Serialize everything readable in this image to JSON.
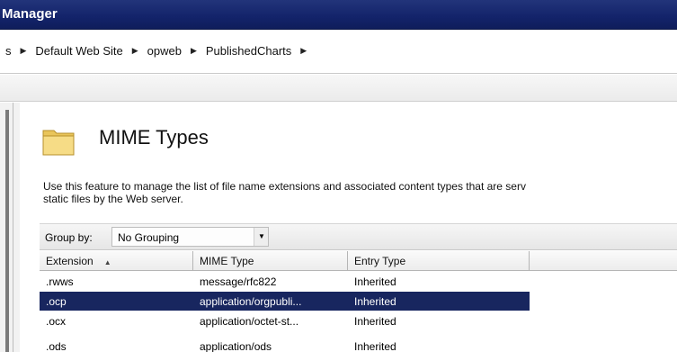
{
  "window": {
    "title": "Manager"
  },
  "breadcrumb": [
    "s",
    "Default Web Site",
    "opweb",
    "PublishedCharts"
  ],
  "feature": {
    "title": "MIME Types",
    "description_line1": "Use this feature to manage the list of file name extensions and associated content types that are serv",
    "description_line2": "static files by the Web server.",
    "icon": "folder-icon"
  },
  "groupby": {
    "label": "Group by:",
    "value": "No Grouping"
  },
  "table": {
    "columns": [
      "Extension",
      "MIME Type",
      "Entry Type"
    ],
    "sort_indicator": "▲",
    "rows": [
      {
        "extension": ".rwws",
        "mime": "message/rfc822",
        "entry": "Inherited",
        "selected": false
      },
      {
        "extension": ".ocp",
        "mime": "application/orgpubli...",
        "entry": "Inherited",
        "selected": true
      },
      {
        "extension": ".ocx",
        "mime": "application/octet-st...",
        "entry": "Inherited",
        "selected": false
      },
      {
        "extension": ".ods",
        "mime": "application/ods",
        "entry": "Inherited",
        "selected": false
      }
    ]
  },
  "colors": {
    "titlebar": "#13236a",
    "selection": "#18265f"
  }
}
